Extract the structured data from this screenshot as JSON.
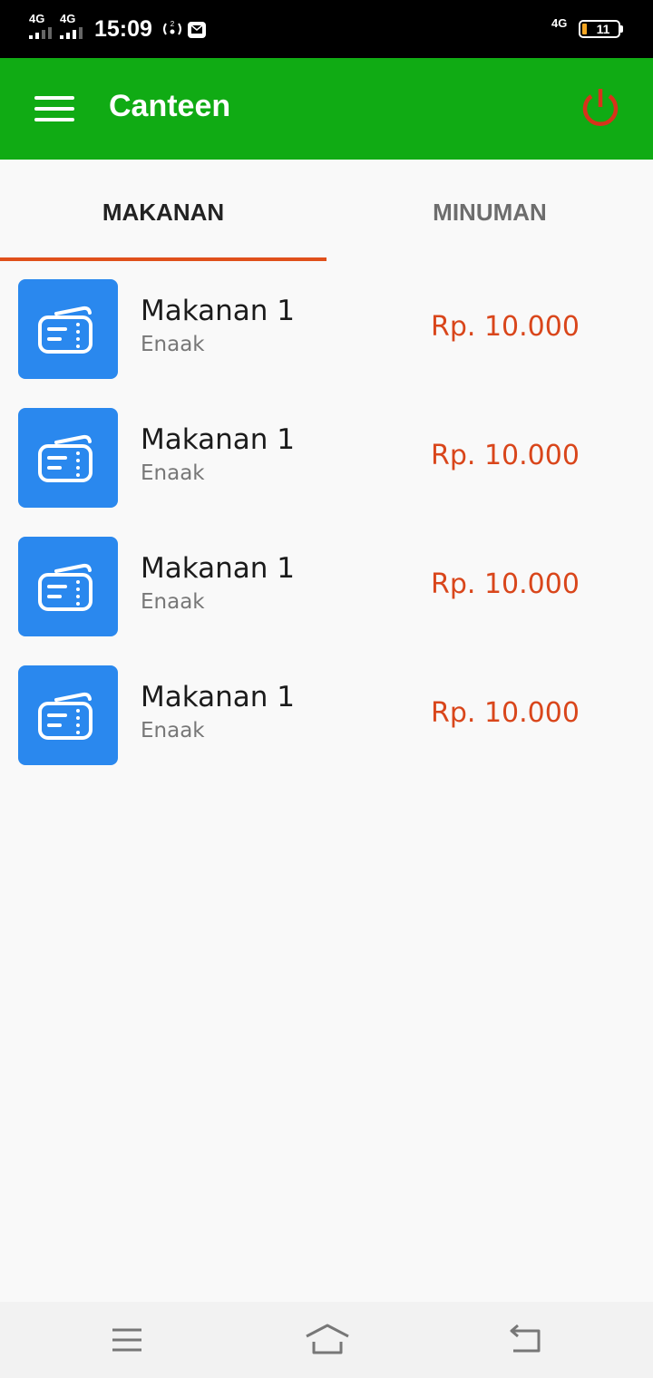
{
  "status_bar": {
    "network_1": "4G",
    "network_2": "4G",
    "time": "15:09",
    "right_network": "4G",
    "battery_level": "11",
    "icons": [
      "signal-icon",
      "signal-icon",
      "hotspot-icon",
      "message-icon",
      "network-icon",
      "battery-icon"
    ]
  },
  "app_bar": {
    "title": "Canteen",
    "menu_icon": "hamburger-menu-icon",
    "power_icon": "power-icon",
    "color": "#10ab14",
    "power_color": "#d8321b"
  },
  "tabs": [
    {
      "label": "MAKANAN",
      "active": true
    },
    {
      "label": "MINUMAN",
      "active": false
    }
  ],
  "accent_color": "#e0501b",
  "items": [
    {
      "name": "Makanan 1",
      "description": "Enaak",
      "price": "Rp. 10.000",
      "icon": "ticket-icon"
    },
    {
      "name": "Makanan 1",
      "description": "Enaak",
      "price": "Rp. 10.000",
      "icon": "ticket-icon"
    },
    {
      "name": "Makanan 1",
      "description": "Enaak",
      "price": "Rp. 10.000",
      "icon": "ticket-icon"
    },
    {
      "name": "Makanan 1",
      "description": "Enaak",
      "price": "Rp. 10.000",
      "icon": "ticket-icon"
    }
  ],
  "nav_bar": {
    "icons": [
      "menu-icon",
      "home-icon",
      "back-icon"
    ]
  }
}
